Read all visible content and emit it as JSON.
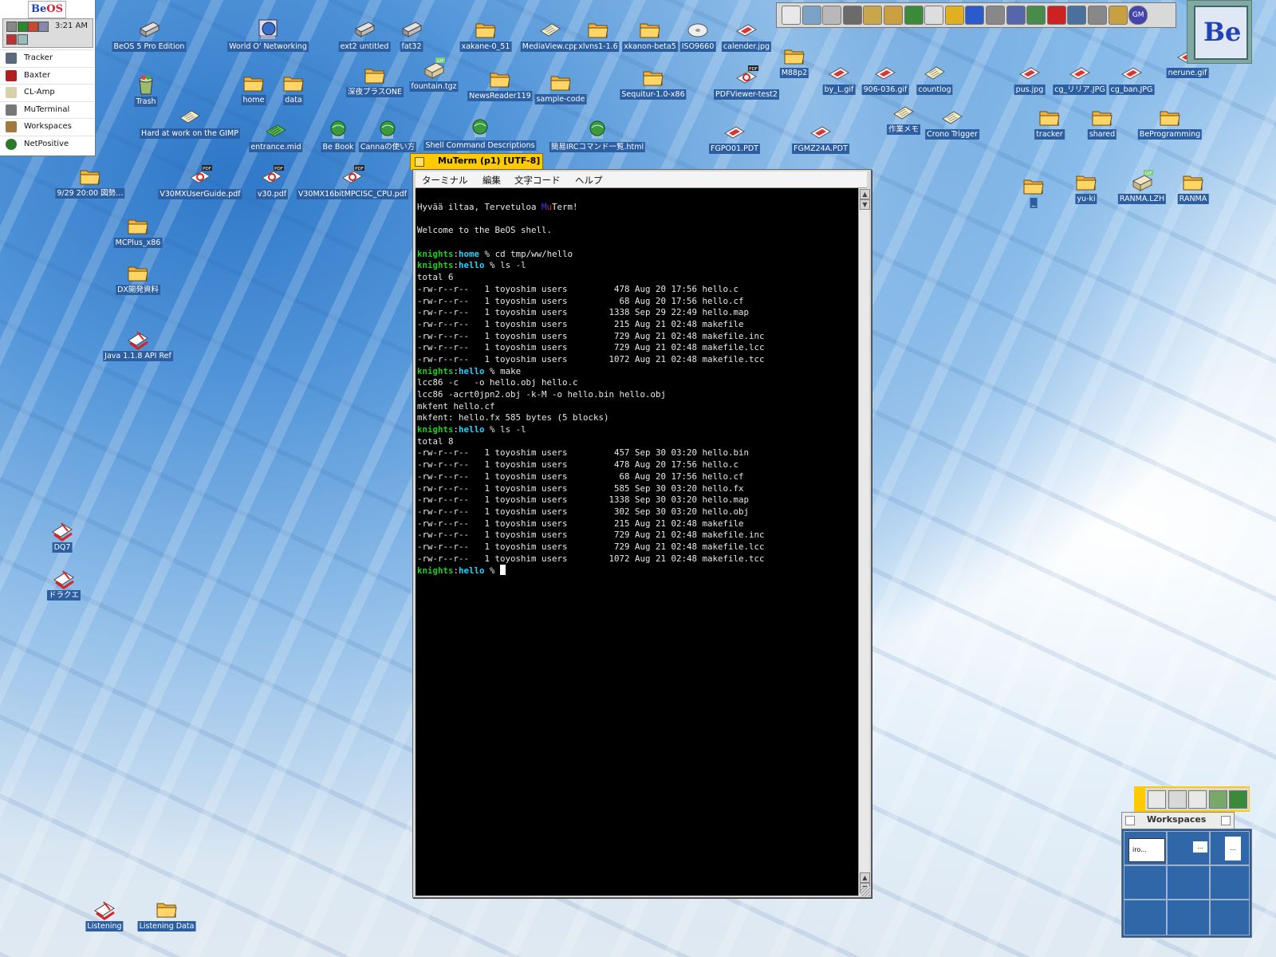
{
  "deskbar": {
    "logo_b": "Be",
    "logo_os": "OS",
    "clock": "3:21 AM",
    "items": [
      {
        "label": "Tracker",
        "icon": "tracker-icon"
      },
      {
        "label": "Baxter",
        "icon": "baxter-icon"
      },
      {
        "label": "CL-Amp",
        "icon": "cl-amp-icon"
      },
      {
        "label": "MuTerminal",
        "icon": "muterminal-icon"
      },
      {
        "label": "Workspaces",
        "icon": "workspaces-icon"
      },
      {
        "label": "NetPositive",
        "icon": "netpositive-icon"
      }
    ]
  },
  "desktop_icons": [
    {
      "label": "BeOS 5 Pro Edition",
      "icon": "disk-icon"
    },
    {
      "label": "World O' Networking",
      "icon": "network-icon"
    },
    {
      "label": "ext2 untitled",
      "icon": "disk-icon"
    },
    {
      "label": "fat32",
      "icon": "disk-icon"
    },
    {
      "label": "xakane-0_51",
      "icon": "folder-icon"
    },
    {
      "label": "MediaView.cpp",
      "icon": "document-icon"
    },
    {
      "label": "xlvns1-1.6",
      "icon": "folder-icon"
    },
    {
      "label": "xkanon-beta5",
      "icon": "folder-icon"
    },
    {
      "label": "ISO9660",
      "icon": "cd-icon"
    },
    {
      "label": "calender.jpg",
      "icon": "image-icon"
    },
    {
      "label": "M88p2",
      "icon": "folder-icon"
    },
    {
      "label": "by_L.gif",
      "icon": "image-icon"
    },
    {
      "label": "906-036.gif",
      "icon": "image-icon"
    },
    {
      "label": "countlog",
      "icon": "document-icon"
    },
    {
      "label": "pus.jpg",
      "icon": "image-icon"
    },
    {
      "label": "cg_リリア.JPG",
      "icon": "image-icon"
    },
    {
      "label": "cg_ban.JPG",
      "icon": "image-icon"
    },
    {
      "label": "nerune.gif",
      "icon": "image-icon"
    },
    {
      "label": "Trash",
      "icon": "trash-icon"
    },
    {
      "label": "home",
      "icon": "folder-icon"
    },
    {
      "label": "data",
      "icon": "folder-icon"
    },
    {
      "label": "深夜プラスONE",
      "icon": "folder-icon"
    },
    {
      "label": "fountain.tgz",
      "icon": "archive-icon"
    },
    {
      "label": "NewsReader119",
      "icon": "folder-icon"
    },
    {
      "label": "sample-code",
      "icon": "folder-icon"
    },
    {
      "label": "Sequitur-1.0-x86",
      "icon": "folder-icon"
    },
    {
      "label": "PDFViewer-test2",
      "icon": "pdf-icon"
    },
    {
      "label": "Hard at work on the GIMP",
      "icon": "document-icon"
    },
    {
      "label": "entrance.mid",
      "icon": "midi-icon"
    },
    {
      "label": "Be Book",
      "icon": "web-icon"
    },
    {
      "label": "Cannaの使い方",
      "icon": "web-icon"
    },
    {
      "label": "Shell Command Descriptions",
      "icon": "web-icon"
    },
    {
      "label": "簡易IRCコマンド一覧.html",
      "icon": "web-icon"
    },
    {
      "label": "FGPO01.PDT",
      "icon": "image-icon"
    },
    {
      "label": "FGMZ24A.PDT",
      "icon": "image-icon"
    },
    {
      "label": "作業メモ",
      "icon": "document-icon"
    },
    {
      "label": "Crono Trigger",
      "icon": "document-icon"
    },
    {
      "label": "tracker",
      "icon": "folder-icon"
    },
    {
      "label": "shared",
      "icon": "folder-icon"
    },
    {
      "label": "BeProgramming",
      "icon": "folder-icon"
    },
    {
      "label": "9/29 20:00 図勢…",
      "icon": "folder-icon"
    },
    {
      "label": "V30MXUserGuide.pdf",
      "icon": "pdf-icon"
    },
    {
      "label": "v30.pdf",
      "icon": "pdf-icon"
    },
    {
      "label": "V30MX16bitMPCISC_CPU.pdf",
      "icon": "pdf-icon"
    },
    {
      "label": "_",
      "icon": "folder-icon"
    },
    {
      "label": "yu-ki",
      "icon": "folder-icon"
    },
    {
      "label": "RANMA.LZH",
      "icon": "archive-icon"
    },
    {
      "label": "RANMA",
      "icon": "folder-icon"
    },
    {
      "label": "MCPlus_x86",
      "icon": "folder-icon"
    },
    {
      "label": "DX開発資料",
      "icon": "folder-icon"
    },
    {
      "label": "Java 1.1.8 API Ref",
      "icon": "book-icon"
    },
    {
      "label": "DQ7",
      "icon": "book-icon"
    },
    {
      "label": "ドラクエ",
      "icon": "book-icon"
    },
    {
      "label": "Listening",
      "icon": "book-icon"
    },
    {
      "label": "Listening Data",
      "icon": "folder-icon"
    }
  ],
  "pdf_badge": "PDF",
  "gif_badge": "GIF",
  "muterm": {
    "title": "MuTerm (p1) [UTF-8]",
    "menus": [
      "ターミナル",
      "編集",
      "文字コード",
      "ヘルプ"
    ],
    "greeting_pre": "Hyvää iltaa, Tervetuloa ",
    "greeting_mu_m": "M",
    "greeting_mu_u": "u",
    "greeting_post": "Term!",
    "welcome": "Welcome to the BeOS shell.",
    "prompt_user": "knights",
    "prompt_sep": ":",
    "prompt_pct": " % ",
    "session": [
      {
        "dir": "home",
        "cmd": "cd tmp/ww/hello",
        "output": []
      },
      {
        "dir": "hello",
        "cmd": "ls -l",
        "output": [
          "total 6",
          "-rw-r--r--   1 toyoshim users         478 Aug 20 17:56 hello.c",
          "-rw-r--r--   1 toyoshim users          68 Aug 20 17:56 hello.cf",
          "-rw-r--r--   1 toyoshim users        1338 Sep 29 22:49 hello.map",
          "-rw-r--r--   1 toyoshim users         215 Aug 21 02:48 makefile",
          "-rw-r--r--   1 toyoshim users         729 Aug 21 02:48 makefile.inc",
          "-rw-r--r--   1 toyoshim users         729 Aug 21 02:48 makefile.lcc",
          "-rw-r--r--   1 toyoshim users        1072 Aug 21 02:48 makefile.tcc"
        ]
      },
      {
        "dir": "hello",
        "cmd": "make",
        "output": [
          "lcc86 -c   -o hello.obj hello.c",
          "lcc86 -acrt0jpn2.obj -k-M -o hello.bin hello.obj",
          "mkfent hello.cf",
          "mkfent: hello.fx 585 bytes (5 blocks)"
        ]
      },
      {
        "dir": "hello",
        "cmd": "ls -l",
        "output": [
          "total 8",
          "-rw-r--r--   1 toyoshim users         457 Sep 30 03:20 hello.bin",
          "-rw-r--r--   1 toyoshim users         478 Aug 20 17:56 hello.c",
          "-rw-r--r--   1 toyoshim users          68 Aug 20 17:56 hello.cf",
          "-rw-r--r--   1 toyoshim users         585 Sep 30 03:20 hello.fx",
          "-rw-r--r--   1 toyoshim users        1338 Sep 30 03:20 hello.map",
          "-rw-r--r--   1 toyoshim users         302 Sep 30 03:20 hello.obj",
          "-rw-r--r--   1 toyoshim users         215 Aug 21 02:48 makefile",
          "-rw-r--r--   1 toyoshim users         729 Aug 21 02:48 makefile.inc",
          "-rw-r--r--   1 toyoshim users         729 Aug 21 02:48 makefile.lcc",
          "-rw-r--r--   1 toyoshim users        1072 Aug 21 02:48 makefile.tcc"
        ]
      }
    ],
    "final_dir": "hello"
  },
  "toolbar_icons": [
    "toolbar-config-icon",
    "stylededit-icon",
    "diskprobe-icon",
    "people-icon",
    "package-icon",
    "globe-icon",
    "pencil-icon",
    "font-icon",
    "eye-icon",
    "tools-icon",
    "chip-icon",
    "flower-icon",
    "gear-icon",
    "acrobat-icon",
    "cdplayer-icon",
    "wrench-icon",
    "grid-icon",
    "gm-icon"
  ],
  "toolbar_gm_label": "GM",
  "clock_logo": "Be",
  "workspaces": {
    "title": "Workspaces",
    "thumb_label": "iro...",
    "dots": "...",
    "tray_icons": [
      "download-icon",
      "sync-icon",
      "copy-icon",
      "box-icon",
      "globe-icon"
    ]
  },
  "colors": {
    "prompt_user": "#1fcf1f",
    "prompt_dir": "#2ad0ff",
    "window_tab": "#ffcb00",
    "icon_label_bg": "#2c5ea2"
  }
}
